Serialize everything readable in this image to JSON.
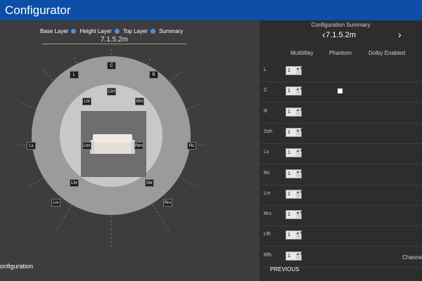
{
  "app": {
    "title": "Configurator"
  },
  "layers": [
    {
      "label": "Base Layer"
    },
    {
      "label": "Height Layer"
    },
    {
      "label": "Top Layer"
    },
    {
      "label": "Summary"
    }
  ],
  "current_config": "7.1.5.2m",
  "speakers": [
    "L",
    "C",
    "R",
    "Lhf",
    "Chf",
    "Rhf",
    "Ls",
    "Ltm",
    "Rtm",
    "Rs",
    "Lhr",
    "Shr",
    "Lrs",
    "Rrs"
  ],
  "bottom_left": "onfiguration",
  "summary": {
    "title": "Configuration Summary",
    "current": "7.1.5.2m",
    "prev_icon": "chevron-left-icon",
    "next_icon": "chevron-right-icon",
    "headers": {
      "multiway": "MultiWay",
      "phantom": "Phantom",
      "dolby": "Dolby Enabled"
    },
    "rows": [
      {
        "label": "L",
        "multiway": "1",
        "phantom": false
      },
      {
        "label": "C",
        "multiway": "1",
        "phantom": true
      },
      {
        "label": "R",
        "multiway": "1",
        "phantom": false
      },
      {
        "label": "Ssh",
        "multiway": "1",
        "phantom": false
      },
      {
        "label": "Ls",
        "multiway": "1",
        "phantom": false
      },
      {
        "label": "Rs",
        "multiway": "1",
        "phantom": false
      },
      {
        "label": "Lrs",
        "multiway": "1",
        "phantom": false
      },
      {
        "label": "Rrs",
        "multiway": "1",
        "phantom": false
      },
      {
        "label": "Lfh",
        "multiway": "1",
        "phantom": false
      },
      {
        "label": "Rfh",
        "multiway": "1",
        "phantom": false
      }
    ],
    "channel_label": "Channe",
    "previous_button": "PREVIOUS"
  },
  "colors": {
    "title_bar": "#0d4ea6",
    "accent": "#4a90e2"
  }
}
